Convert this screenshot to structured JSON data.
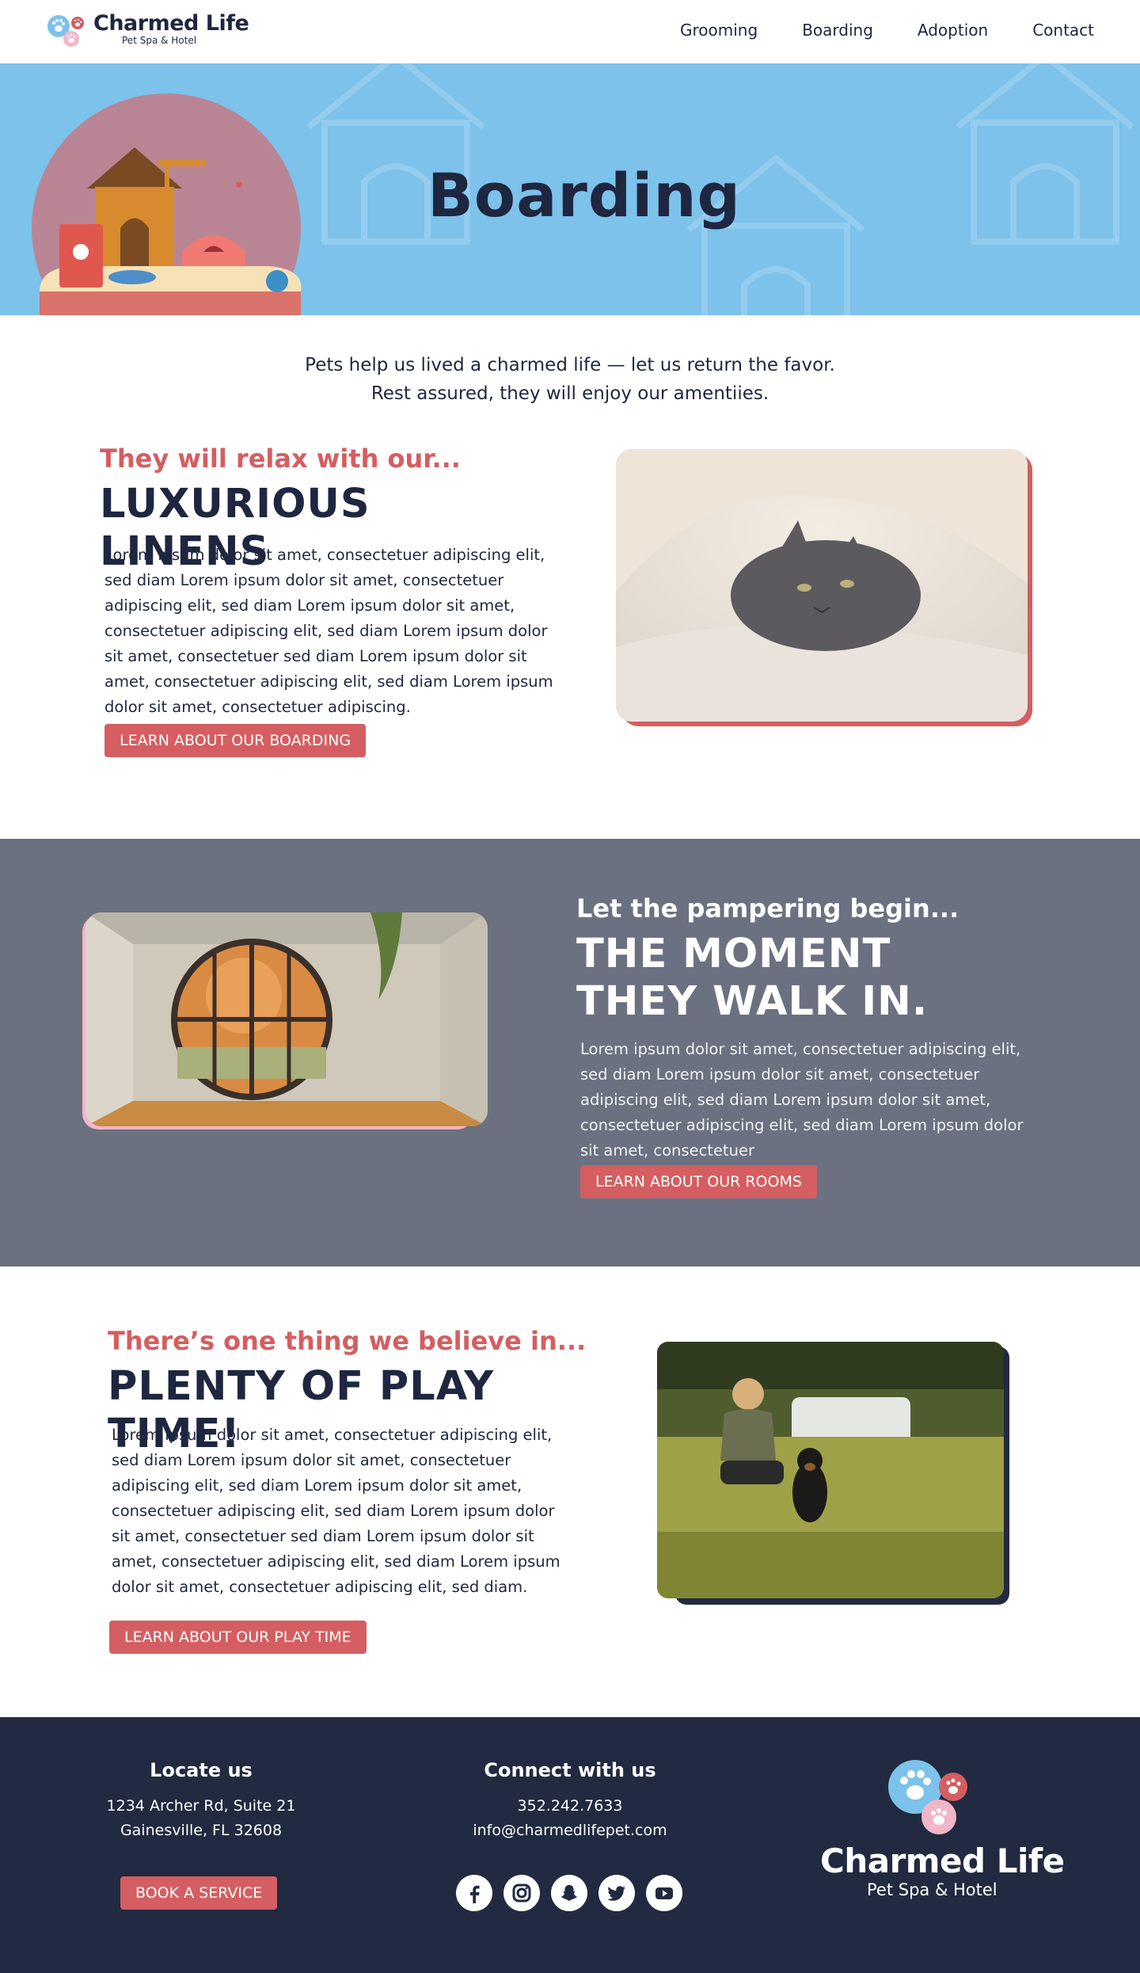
{
  "brand": {
    "name": "Charmed Life",
    "tagline": "Pet Spa & Hotel"
  },
  "nav": {
    "links": [
      "Grooming",
      "Boarding",
      "Adoption",
      "Contact"
    ]
  },
  "hero": {
    "title": "Boarding"
  },
  "intro": {
    "line1": "Pets help us lived a charmed life — let us return the favor.",
    "line2": "Rest assured, they will enjoy our amentiies."
  },
  "sections": [
    {
      "kicker": "They will relax with our...",
      "heading": "LUXURIOUS LINENS",
      "body": "Lorem ipsum dolor sit amet, consectetuer adipiscing elit, sed diam Lorem ipsum dolor sit amet, consectetuer adipiscing elit, sed diam Lorem ipsum dolor sit amet, consectetuer adipiscing elit, sed diam Lorem ipsum dolor sit amet, consectetuer sed diam Lorem ipsum dolor sit amet, consectetuer adipiscing elit, sed diam Lorem ipsum dolor sit amet, consectetuer adipiscing.",
      "button": "LEARN ABOUT OUR BOARDING"
    },
    {
      "kicker": "Let the pampering begin...",
      "heading": "THE MOMENT THEY WALK IN.",
      "body": "Lorem ipsum dolor sit amet, consectetuer adipiscing elit, sed diam Lorem ipsum dolor sit amet, consectetuer adipiscing elit, sed diam Lorem ipsum dolor sit amet, consectetuer adipiscing elit, sed diam Lorem ipsum dolor sit amet, consectetuer",
      "button": "LEARN ABOUT OUR ROOMS"
    },
    {
      "kicker": "There’s one thing we  believe in...",
      "heading": "PLENTY OF PLAY TIME!",
      "body": "Lorem ipsum dolor sit amet, consectetuer adipiscing elit, sed diam Lorem ipsum dolor sit amet, consectetuer adipiscing elit, sed diam Lorem ipsum dolor sit amet, consectetuer adipiscing elit, sed diam Lorem ipsum dolor sit amet, consectetuer sed diam Lorem ipsum dolor sit amet, consectetuer adipiscing elit, sed diam Lorem ipsum dolor sit amet, consectetuer adipiscing elit, sed diam.",
      "button": "LEARN ABOUT OUR PLAY TIME"
    }
  ],
  "footer": {
    "locate": {
      "heading": "Locate us",
      "address1": "1234 Archer Rd, Suite 21",
      "address2": "Gainesville, FL 32608",
      "button": "BOOK A SERVICE"
    },
    "connect": {
      "heading": "Connect with us",
      "phone": "352.242.7633",
      "email": "info@charmedlifepet.com",
      "social": [
        "facebook-icon",
        "instagram-icon",
        "snapchat-icon",
        "twitter-icon",
        "youtube-icon"
      ]
    }
  },
  "colors": {
    "navy": "#1f2640",
    "coral": "#d45e61",
    "sky": "#7cc2ea",
    "slate": "#6b7180",
    "footer": "#212a40",
    "pink": "#f2b6c9"
  }
}
